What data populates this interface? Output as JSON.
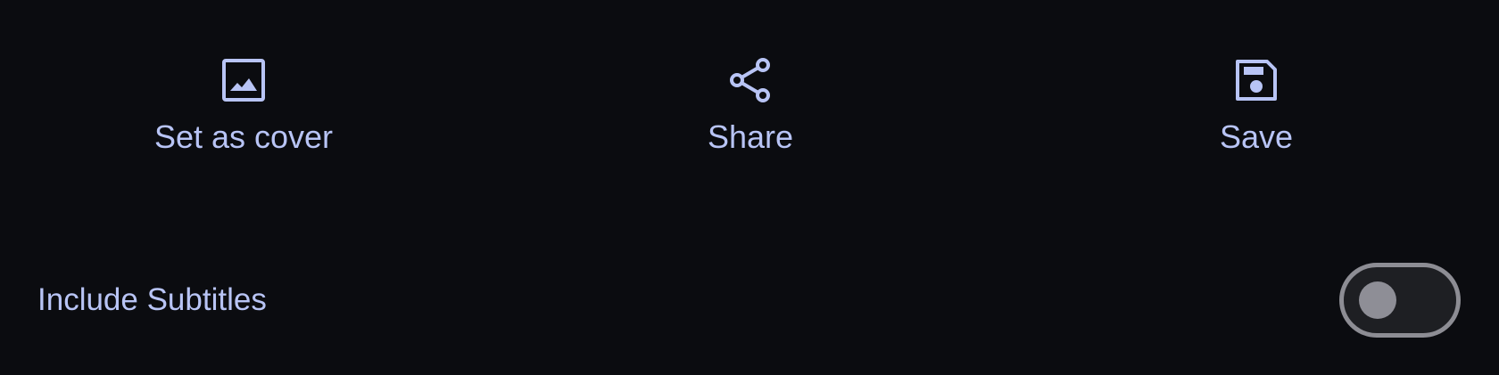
{
  "actions": [
    {
      "label": "Set as cover",
      "icon": "image-icon"
    },
    {
      "label": "Share",
      "icon": "share-icon"
    },
    {
      "label": "Save",
      "icon": "save-icon"
    }
  ],
  "subtitles_row": {
    "label": "Include Subtitles",
    "toggle_on": false
  },
  "colors": {
    "background": "#0b0c10",
    "accent": "#b8c4f5",
    "toggle_border": "#8d8d94",
    "toggle_thumb": "#8e8e96"
  }
}
